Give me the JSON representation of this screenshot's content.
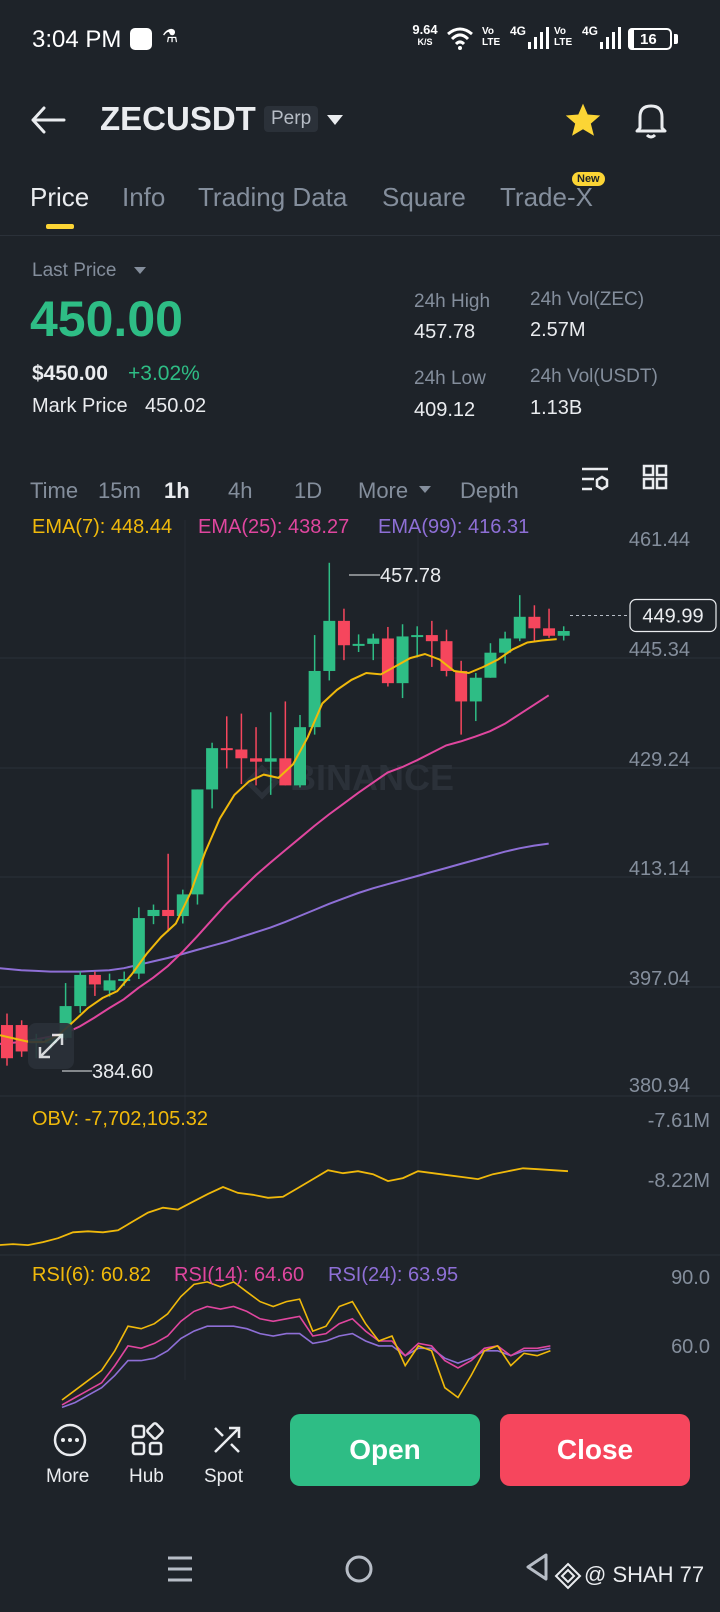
{
  "status_bar": {
    "time": "3:04 PM",
    "speed_value": "9.64",
    "speed_unit": "K/S",
    "lte1": "Vo\nLTE",
    "net1": "4G",
    "lte2": "Vo\nLTE",
    "net2": "4G",
    "battery": "16"
  },
  "header": {
    "symbol": "ZECUSDT",
    "contract_type": "Perp"
  },
  "tabs": [
    {
      "label": "Price"
    },
    {
      "label": "Info"
    },
    {
      "label": "Trading Data"
    },
    {
      "label": "Square"
    },
    {
      "label": "Trade-X",
      "badge": "New"
    }
  ],
  "ticker": {
    "last_price_label": "Last Price",
    "last_price": "450.00",
    "usd_price": "$450.00",
    "change_pct": "+3.02%",
    "mark_price_label": "Mark Price",
    "mark_price": "450.02",
    "high_label": "24h High",
    "high": "457.78",
    "vol_base_label": "24h Vol(ZEC)",
    "vol_base": "2.57M",
    "low_label": "24h Low",
    "low": "409.12",
    "vol_quote_label": "24h Vol(USDT)",
    "vol_quote": "1.13B"
  },
  "timeframes": {
    "items": [
      "Time",
      "15m",
      "1h",
      "4h",
      "1D",
      "More",
      "Depth"
    ],
    "active": "1h"
  },
  "indicators": {
    "ema7": "EMA(7): 448.44",
    "ema25": "EMA(25): 438.27",
    "ema99": "EMA(99): 416.31",
    "obv": "OBV: -7,702,105.32",
    "rsi6": "RSI(6): 60.82",
    "rsi14": "RSI(14): 64.60",
    "rsi24": "RSI(24): 63.95"
  },
  "colors": {
    "up": "#2ebd85",
    "down": "#f6465d",
    "ema7": "#f0b90b",
    "ema25": "#e0469f",
    "ema99": "#8e6fd6",
    "background": "#1e2329",
    "accent": "#fcd535"
  },
  "chart_data": {
    "type": "candlestick",
    "price_axis_ticks": [
      "461.44",
      "445.34",
      "429.24",
      "413.14",
      "397.04",
      "380.94"
    ],
    "high_marker": "457.78",
    "low_marker": "384.60",
    "current_price_label": "449.99",
    "watermark": "BINANCE",
    "ylim": [
      380.94,
      461.44
    ],
    "candles": [
      {
        "o": 389.5,
        "h": 391.2,
        "l": 383.5,
        "c": 384.6
      },
      {
        "o": 389.5,
        "h": 390.2,
        "l": 384.8,
        "c": 385.6
      },
      {
        "o": 386.8,
        "h": 388.2,
        "l": 384.6,
        "c": 387.4
      },
      {
        "o": 386.8,
        "h": 388.0,
        "l": 385.8,
        "c": 387.6
      },
      {
        "o": 387.6,
        "h": 395.7,
        "l": 387.3,
        "c": 392.3
      },
      {
        "o": 392.3,
        "h": 397.4,
        "l": 391.3,
        "c": 396.9
      },
      {
        "o": 396.9,
        "h": 397.4,
        "l": 393.8,
        "c": 395.5
      },
      {
        "o": 394.6,
        "h": 397.1,
        "l": 393.7,
        "c": 396.1
      },
      {
        "o": 396.0,
        "h": 397.4,
        "l": 395.3,
        "c": 396.3
      },
      {
        "o": 397.1,
        "h": 406.9,
        "l": 396.3,
        "c": 405.3
      },
      {
        "o": 405.6,
        "h": 407.3,
        "l": 404.4,
        "c": 406.5
      },
      {
        "o": 406.5,
        "h": 414.8,
        "l": 403.3,
        "c": 405.6
      },
      {
        "o": 405.6,
        "h": 409.5,
        "l": 404.5,
        "c": 408.8
      },
      {
        "o": 408.8,
        "h": 424.3,
        "l": 407.3,
        "c": 424.3
      },
      {
        "o": 424.3,
        "h": 431.2,
        "l": 421.5,
        "c": 430.4
      },
      {
        "o": 430.4,
        "h": 435.1,
        "l": 427.4,
        "c": 430.2
      },
      {
        "o": 430.2,
        "h": 435.5,
        "l": 425.1,
        "c": 428.9
      },
      {
        "o": 428.9,
        "h": 433.5,
        "l": 424.9,
        "c": 428.4
      },
      {
        "o": 428.4,
        "h": 435.7,
        "l": 423.5,
        "c": 428.9
      },
      {
        "o": 428.9,
        "h": 437.3,
        "l": 424.9,
        "c": 424.9
      },
      {
        "o": 424.9,
        "h": 435.3,
        "l": 424.6,
        "c": 433.5
      },
      {
        "o": 433.5,
        "h": 447.1,
        "l": 432.4,
        "c": 441.8
      },
      {
        "o": 441.8,
        "h": 457.78,
        "l": 440.4,
        "c": 449.2
      },
      {
        "o": 449.2,
        "h": 451.0,
        "l": 443.4,
        "c": 445.6
      },
      {
        "o": 445.6,
        "h": 447.2,
        "l": 444.6,
        "c": 445.8
      },
      {
        "o": 445.8,
        "h": 447.3,
        "l": 443.4,
        "c": 446.6
      },
      {
        "o": 446.6,
        "h": 448.3,
        "l": 439.5,
        "c": 440.0
      },
      {
        "o": 440.0,
        "h": 448.7,
        "l": 437.8,
        "c": 446.9
      },
      {
        "o": 446.9,
        "h": 448.4,
        "l": 443.8,
        "c": 447.1
      },
      {
        "o": 447.1,
        "h": 449.2,
        "l": 442.4,
        "c": 446.2
      },
      {
        "o": 446.2,
        "h": 447.9,
        "l": 441.0,
        "c": 441.8
      },
      {
        "o": 441.8,
        "h": 443.3,
        "l": 432.4,
        "c": 437.3
      },
      {
        "o": 437.3,
        "h": 441.5,
        "l": 434.4,
        "c": 440.8
      },
      {
        "o": 440.8,
        "h": 445.9,
        "l": 440.8,
        "c": 444.5
      },
      {
        "o": 444.5,
        "h": 447.6,
        "l": 442.9,
        "c": 446.6
      },
      {
        "o": 446.6,
        "h": 453.0,
        "l": 446.2,
        "c": 449.8
      },
      {
        "o": 449.8,
        "h": 451.5,
        "l": 446.3,
        "c": 448.1
      },
      {
        "o": 448.1,
        "h": 451.0,
        "l": 446.7,
        "c": 447.0
      },
      {
        "o": 447.0,
        "h": 448.4,
        "l": 446.3,
        "c": 447.7
      }
    ],
    "ema7": [
      388,
      387.5,
      387,
      387,
      388,
      390,
      392,
      393.5,
      394.5,
      397,
      400,
      402.5,
      404.5,
      409,
      415,
      420,
      423.5,
      425.5,
      426.5,
      426,
      428,
      432,
      437,
      439,
      440.5,
      441.5,
      441.3,
      442.5,
      443.7,
      444.3,
      443.5,
      441.8,
      441.5,
      442.4,
      443.5,
      445,
      446,
      446.3,
      446.5
    ],
    "ema25": [
      386.6,
      386.8,
      387,
      387.4,
      387.8,
      388.3,
      389.3,
      390.6,
      392,
      393.3,
      395,
      396.5,
      398.2,
      400.3,
      402.6,
      405,
      407.4,
      409.5,
      411.6,
      413.5,
      415.3,
      417.1,
      418.9,
      420.6,
      422.2,
      423.8,
      425.3,
      426.8,
      427.6,
      428.6,
      429.7,
      430.8,
      431.4,
      432.1,
      432.9,
      434,
      435.4,
      436.8,
      438.2
    ],
    "ema99": [
      398.0,
      397.8,
      397.6,
      397.5,
      397.4,
      397.4,
      397.4,
      397.5,
      397.6,
      397.9,
      398.4,
      398.9,
      399.4,
      400.0,
      400.6,
      401.2,
      401.8,
      402.5,
      403.2,
      403.9,
      404.7,
      405.6,
      406.5,
      407.4,
      408.2,
      409.0,
      409.7,
      410.3,
      410.9,
      411.5,
      412.1,
      412.7,
      413.3,
      413.9,
      414.5,
      415.1,
      415.6,
      416.0,
      416.3
    ],
    "obv_axis": [
      "-7.61M",
      "-8.22M"
    ],
    "obv": [
      -8.77,
      -8.76,
      -8.77,
      -8.74,
      -8.7,
      -8.64,
      -8.63,
      -8.64,
      -8.62,
      -8.53,
      -8.44,
      -8.39,
      -8.41,
      -8.33,
      -8.25,
      -8.18,
      -8.24,
      -8.26,
      -8.29,
      -8.28,
      -8.19,
      -8.1,
      -8.01,
      -8.04,
      -8.02,
      -8.05,
      -8.12,
      -8.09,
      -8.02,
      -8.04,
      -8.06,
      -8.08,
      -8.1,
      -8.05,
      -8.02,
      -7.99,
      -8.0,
      -8.01,
      -8.02
    ],
    "rsi_axis": [
      "90.0",
      "60.0"
    ],
    "rsi6": [
      40,
      44,
      48,
      52,
      60,
      70,
      69,
      71,
      75,
      82,
      87,
      88,
      86,
      88,
      84,
      80,
      78,
      80,
      81,
      68,
      70,
      78,
      80,
      71,
      64,
      66,
      54,
      62,
      60,
      45,
      41,
      50,
      60,
      62,
      54,
      59,
      58,
      60
    ],
    "rsi14": [
      38,
      41,
      44,
      47,
      54,
      62,
      61,
      63,
      66,
      72,
      76,
      78,
      77,
      78,
      76,
      73,
      72,
      73,
      74,
      66,
      67,
      71,
      73,
      68,
      64,
      64,
      58,
      63,
      62,
      56,
      53,
      56,
      61,
      62,
      58,
      61,
      61,
      62
    ],
    "rsi24": [
      37,
      39,
      42,
      45,
      50,
      56,
      56,
      57,
      60,
      65,
      68,
      70,
      70,
      70,
      69,
      67,
      66,
      67,
      67,
      63,
      64,
      66,
      67,
      64,
      62,
      62,
      58,
      61,
      61,
      57,
      55,
      57,
      60,
      60,
      58,
      60,
      60,
      61
    ]
  },
  "bottom_bar": {
    "more": "More",
    "hub": "Hub",
    "spot": "Spot",
    "open": "Open",
    "close": "Close"
  },
  "nav": {
    "watermark_text": "@ SHAH 77"
  }
}
